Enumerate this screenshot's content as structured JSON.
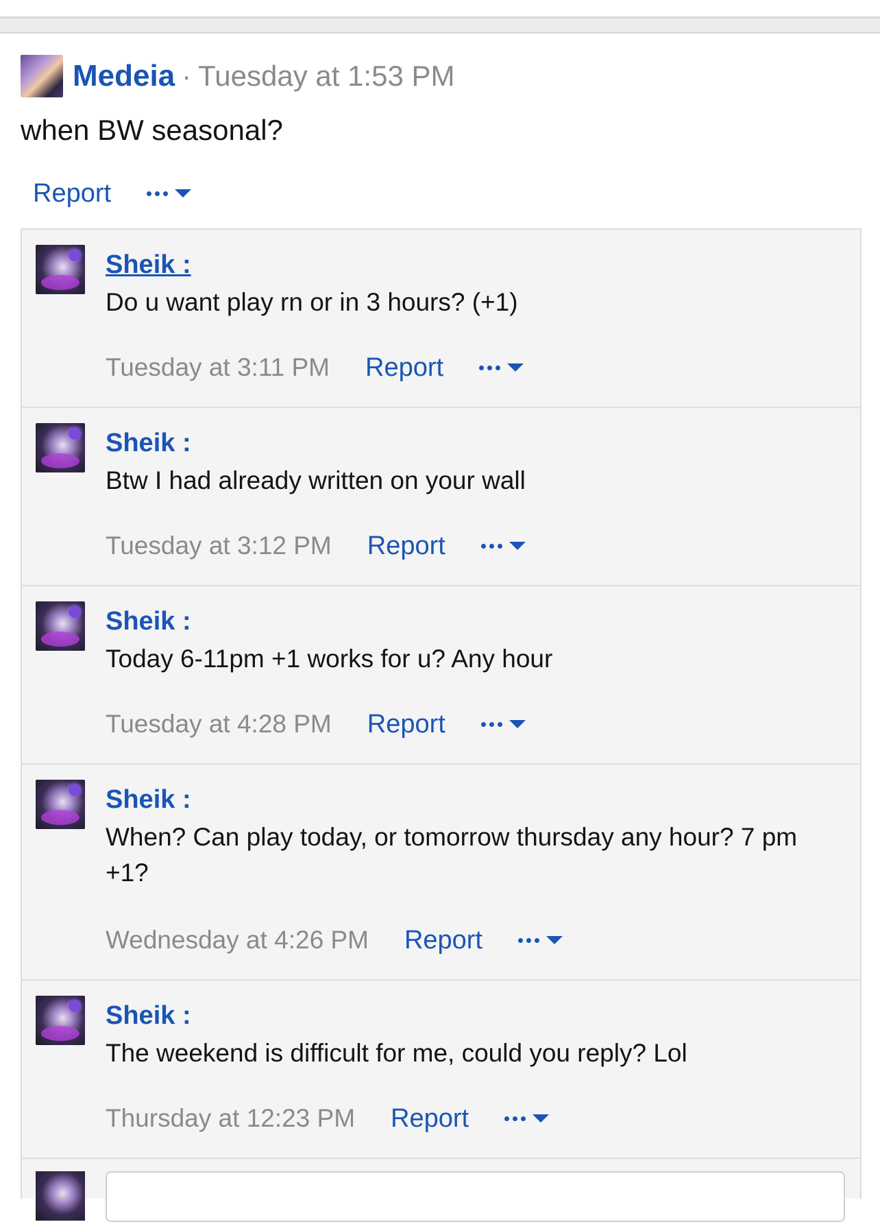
{
  "post": {
    "author": "Medeia",
    "separator": "·",
    "time": "Tuesday at 1:53 PM",
    "text": "when BW seasonal?",
    "report_label": "Report"
  },
  "comments": [
    {
      "author": "Sheik :",
      "text": "Do u want play rn or in 3 hours? (+1)",
      "time": "Tuesday at 3:11 PM",
      "report_label": "Report"
    },
    {
      "author": "Sheik :",
      "text": "Btw I had already written on your wall",
      "time": "Tuesday at 3:12 PM",
      "report_label": "Report"
    },
    {
      "author": "Sheik :",
      "text": "Today 6-11pm +1 works for u? Any hour",
      "time": "Tuesday at 4:28 PM",
      "report_label": "Report"
    },
    {
      "author": "Sheik :",
      "text": "When? Can play today, or tomorrow thursday any hour? 7 pm +1?",
      "time": "Wednesday at 4:26 PM",
      "report_label": "Report"
    },
    {
      "author": "Sheik :",
      "text": "The weekend is difficult for me, could you reply? Lol",
      "time": "Thursday at 12:23 PM",
      "report_label": "Report"
    }
  ],
  "reply": {
    "placeholder": ""
  },
  "colors": {
    "link": "#1a55b5",
    "muted": "#8a8a8a",
    "panel": "#f4f4f4"
  },
  "icons": {
    "more": "ellipsis-icon",
    "caret": "caret-down-icon"
  }
}
